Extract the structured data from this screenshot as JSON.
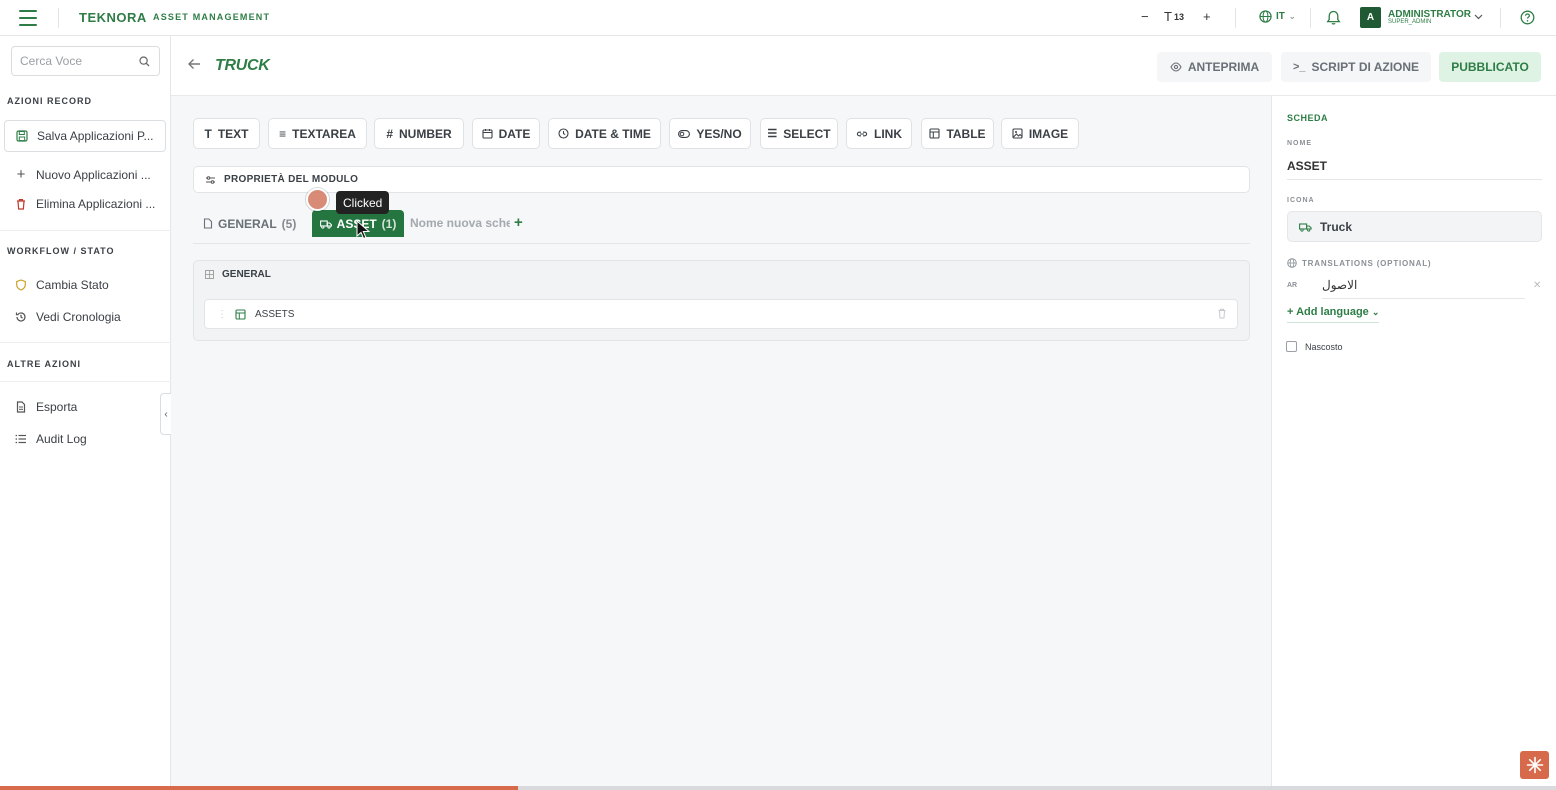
{
  "topbar": {
    "brand": "TEKNORA",
    "brand_sub": "ASSET MANAGEMENT",
    "zoom_minus": "−",
    "font_size": "13",
    "zoom_plus": "+",
    "language": "IT",
    "avatar_letter": "A",
    "user_name": "ADMINISTRATOR",
    "user_role": "SUPER_ADMIN"
  },
  "sidebar": {
    "search_placeholder": "Cerca Voce",
    "sections": [
      {
        "title": "AZIONI RECORD",
        "items": [
          {
            "label": "Salva Applicazioni P...",
            "icon": "save-icon"
          },
          {
            "label": "Nuovo Applicazioni ...",
            "icon": "plus-icon"
          },
          {
            "label": "Elimina Applicazioni ...",
            "icon": "trash-icon"
          }
        ]
      },
      {
        "title": "WORKFLOW / STATO",
        "items": [
          {
            "label": "Cambia Stato",
            "icon": "shield-icon"
          },
          {
            "label": "Vedi Cronologia",
            "icon": "history-icon"
          }
        ]
      },
      {
        "title": "ALTRE AZIONI",
        "items": [
          {
            "label": "Esporta",
            "icon": "file-icon"
          },
          {
            "label": "Audit Log",
            "icon": "list-icon"
          }
        ]
      }
    ]
  },
  "header": {
    "title": "TRUCK",
    "preview_label": "ANTEPRIMA",
    "script_label": "SCRIPT DI AZIONE",
    "publish_label": "PUBBLICATO"
  },
  "toolbar": {
    "field_types": [
      "TEXT",
      "TEXTAREA",
      "NUMBER",
      "DATE",
      "DATE & TIME",
      "YES/NO",
      "SELECT",
      "LINK",
      "TABLE",
      "IMAGE"
    ]
  },
  "module": {
    "properties_label": "PROPRIETÀ DEL MODULO",
    "tabs": [
      {
        "label": "GENERAL",
        "count": "(5)"
      },
      {
        "label": "ASSET",
        "count": "(1)"
      }
    ],
    "new_tab_placeholder": "Nome nuova scheda",
    "section_title": "GENERAL",
    "field_label": "ASSETS",
    "tooltip": "Clicked"
  },
  "panel": {
    "heading": "SCHEDA",
    "name_label": "NOME",
    "name_value": "ASSET",
    "icon_label": "ICONA",
    "icon_value": "Truck",
    "translations_label": "TRANSLATIONS (OPTIONAL)",
    "translation_code": "AR",
    "translation_value": "الاصول",
    "add_language": "+ Add language",
    "hidden_label": "Nascosto"
  },
  "progress": {
    "fraction": 0.333
  },
  "colors": {
    "brand_green": "#2e7d46",
    "active_tab": "#24753f",
    "accent": "#d66a4a"
  }
}
